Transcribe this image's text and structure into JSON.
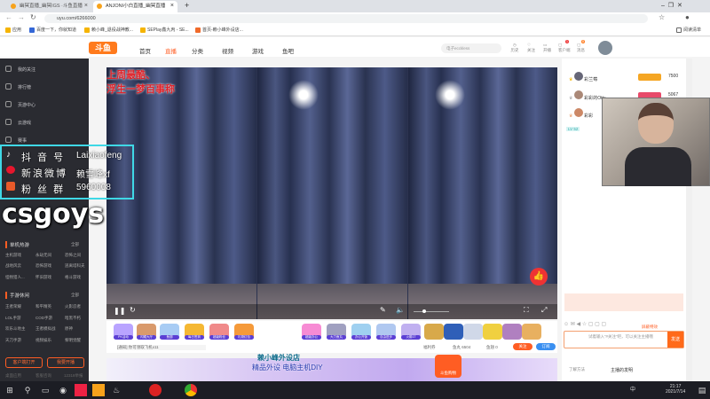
{
  "browser": {
    "tabs": [
      {
        "title": "幽冥直播_幽冥IGS ·斗鱼直播"
      },
      {
        "title": "ANJONI小白直播_幽冥直播"
      }
    ],
    "new_tab": "+",
    "url": "uyu.com/6266000",
    "bookmarks": [
      "应用",
      "百度一下，你就知道",
      "赖小峰_退役战神教...",
      "SEPlay鑫九丙 - SE...",
      "首页-赖小峰外设店..."
    ],
    "reading_list": "阅读清单"
  },
  "header": {
    "logo": "斗鱼",
    "nav": [
      "首页",
      "直播",
      "分类",
      "视频",
      "游戏",
      "鱼吧"
    ],
    "search_placeholder": "电子ecckless",
    "icons": [
      "历史",
      "关注",
      "开播",
      "客户端",
      "消息"
    ],
    "badges": [
      "1",
      "8"
    ]
  },
  "sidebar": {
    "items": [
      "我的关注",
      "排行榜",
      "页游中心",
      "云游戏",
      "赛事"
    ],
    "sections": [
      {
        "title": "单机热游",
        "more": "全部",
        "games": [
          "主机游戏",
          "永劫无间",
          "恐怖之间",
          "战地风云",
          "恐怖游戏",
          "逃离塔科夫",
          "怪物猎人...",
          "怀旧游戏",
          "格斗游戏"
        ]
      },
      {
        "title": "手游休闲",
        "more": "全部",
        "games": [
          "王者荣耀",
          "和平精英",
          "火影忍者",
          "LOL手游",
          "COD手游",
          "暗黑不朽",
          "欢乐斗地主",
          "王者模拟战",
          "原神",
          "天刀手游",
          "视频娱乐",
          "黎明觉醒"
        ]
      }
    ],
    "buttons": [
      "客户端打开",
      "我要开播"
    ],
    "footer": [
      "桌面应用",
      "客服咨询",
      "12318举报"
    ]
  },
  "overlay": {
    "rows": [
      {
        "label": "抖 音 号",
        "value": "Laixiaofeng"
      },
      {
        "label": "新浪微博",
        "value": "赖雪峰xf"
      },
      {
        "label": "粉 丝 群",
        "value": "5960008"
      }
    ],
    "big": "csgoys"
  },
  "video": {
    "title_line1": "上周最酷、",
    "title_line2": "浮生一梦百事称"
  },
  "gifts": [
    "PK活动",
    "闪耀大厅",
    "鱼翅",
    "每日签到",
    "超级粉丝",
    "礼物红包",
    "超级办公",
    "大力鱼丸",
    "办公开饭",
    "自由进步",
    "火箭1T"
  ],
  "info": {
    "notice": "[通知] 你可领取飞机x11",
    "report": "福利券",
    "fans": "鱼丸 6504",
    "gifts": "鱼翅 0",
    "follow": "关注",
    "subscribe": "订阅"
  },
  "banner": {
    "line1": "赖小峰外设店",
    "line2": "精品外设 电脑主机DIY",
    "tag": "斗鱼购物"
  },
  "right": {
    "ranks": [
      {
        "name": "彩兰莓",
        "score": "7500"
      },
      {
        "name": "彩彩的Otty",
        "score": "5067"
      },
      {
        "name": "彩彩",
        "score": ""
      }
    ],
    "level": "LV 52",
    "chat_placeholder": "试着输入“#关注”吧，可以关注主播哦",
    "send": "发送",
    "shield": "屏蔽特效",
    "tabs": [
      "了解方法",
      "主播的发明"
    ]
  },
  "taskbar": {
    "time": "21:17",
    "date": "2021/7/14",
    "ime": "中"
  },
  "colors": {
    "accent": "#ff5d23",
    "sidebar": "#2a2b31",
    "overlay_border": "#3fd8e6"
  }
}
